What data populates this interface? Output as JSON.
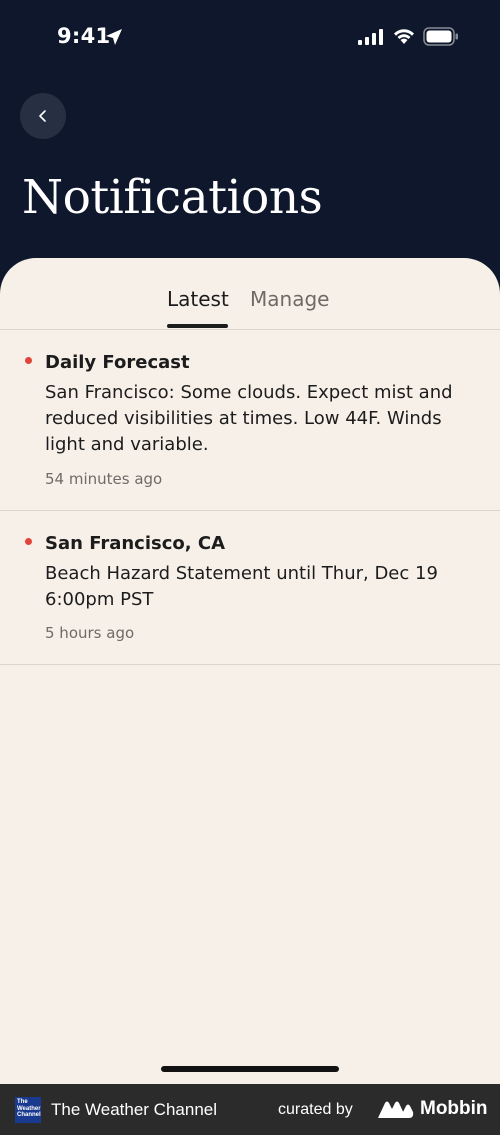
{
  "status_bar": {
    "time": "9:41",
    "icons": [
      "location-arrow-icon",
      "cellular-signal-icon",
      "wifi-icon",
      "battery-icon"
    ]
  },
  "header": {
    "back_icon": "chevron-left-icon",
    "title": "Notifications"
  },
  "tabs": [
    {
      "label": "Latest",
      "active": true
    },
    {
      "label": "Manage",
      "active": false
    }
  ],
  "notifications": [
    {
      "title": "Daily Forecast",
      "body": "San Francisco: Some clouds. Expect mist and reduced visibilities at times. Low 44F. Winds light and variable.",
      "time": "54 minutes ago",
      "unread": true
    },
    {
      "title": "San Francisco, CA",
      "body": "Beach Hazard Statement until Thur, Dec 19 6:00pm PST",
      "time": "5 hours ago",
      "unread": true
    }
  ],
  "footer": {
    "app_logo_text": "The Weather Channel",
    "app_name": "The Weather Channel",
    "curated_by": "curated by",
    "brand": "Mobbin"
  },
  "colors": {
    "header_bg": "#0e172b",
    "sheet_bg": "#f7f0e9",
    "unread_dot": "#e0443b",
    "footer_bg": "#2b2b2b"
  }
}
